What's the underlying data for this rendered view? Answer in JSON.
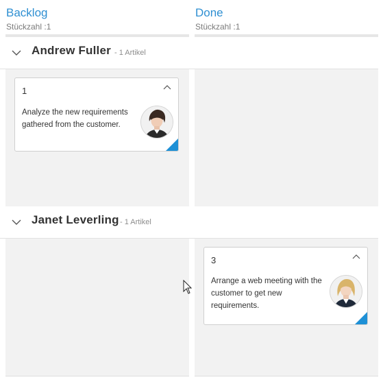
{
  "columns": [
    {
      "title": "Backlog",
      "count_label": "Stückzahl :1"
    },
    {
      "title": "Done",
      "count_label": "Stückzahl :1"
    }
  ],
  "swimlanes": [
    {
      "name": "Andrew Fuller",
      "items_label": "- 1 Artikel"
    },
    {
      "name": "Janet Leverling",
      "items_label": "- 1 Artikel"
    }
  ],
  "cards": [
    {
      "id": "1",
      "summary": "Analyze the new requirements gathered from the customer.",
      "assignee_icon": "avatar-woman-dark-hair"
    },
    {
      "id": "3",
      "summary": "Arrange a web meeting with the customer to get new requirements.",
      "assignee_icon": "avatar-woman-blonde"
    }
  ],
  "colors": {
    "accent": "#2e8fd2",
    "card_corner": "#1e90d6",
    "cell_background": "#f2f2f2"
  }
}
